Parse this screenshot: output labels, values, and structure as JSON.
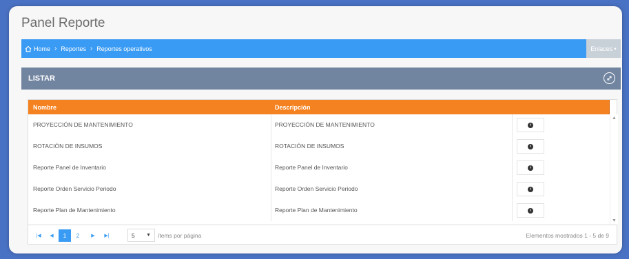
{
  "page": {
    "title": "Panel Reporte"
  },
  "breadcrumb": {
    "items": [
      "Home",
      "Reportes",
      "Reportes operativos"
    ]
  },
  "enlaces": {
    "label": "Enlaces"
  },
  "listar": {
    "title": "LISTAR"
  },
  "grid": {
    "columns": [
      "Nombre",
      "Descripción"
    ],
    "rows": [
      {
        "nombre": "PROYECCIÓN DE MANTENIMIENTO",
        "descripcion": "PROYECCIÓN DE MANTENIMIENTO"
      },
      {
        "nombre": "ROTACIÓN DE INSUMOS",
        "descripcion": "ROTACIÓN DE INSUMOS"
      },
      {
        "nombre": "Reporte Panel de Inventario",
        "descripcion": "Reporte Panel de Inventario"
      },
      {
        "nombre": "Reporte Orden Servicio Periodo",
        "descripcion": "Reporte Orden Servicio Periodo"
      },
      {
        "nombre": "Reporte Plan de Mantenimiento",
        "descripcion": "Reporte Plan de Mantenimiento"
      }
    ]
  },
  "pager": {
    "pages": [
      "1",
      "2"
    ],
    "current_page": "1",
    "page_size": "5",
    "per_page_label": "ítems por página",
    "shown_label": "Elementos mostrados 1 - 5 de 9"
  },
  "colors": {
    "primary": "#3a9bf4",
    "header": "#f58220",
    "listar": "#7285a0"
  }
}
